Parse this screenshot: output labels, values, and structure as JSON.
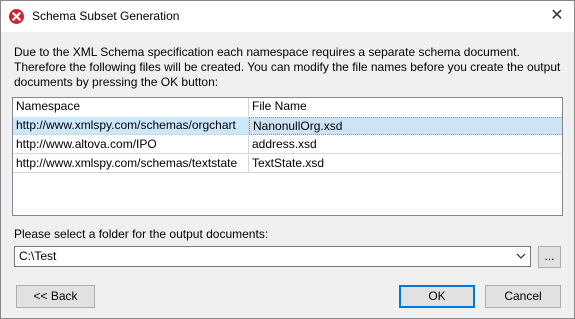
{
  "window": {
    "title": "Schema Subset Generation",
    "close_glyph": "✕"
  },
  "description": {
    "line1": "Due to the XML Schema specification each namespace requires a separate schema document.",
    "line2": "Therefore the following files will be created. You can modify the file names before you create the output",
    "line3": "documents by pressing the OK button:"
  },
  "table": {
    "headers": {
      "namespace": "Namespace",
      "file_name": "File Name"
    },
    "rows": [
      {
        "namespace": "http://www.xmlspy.com/schemas/orgchart",
        "file_name": "NanonullOrg.xsd",
        "selected": true
      },
      {
        "namespace": "http://www.altova.com/IPO",
        "file_name": "address.xsd",
        "selected": false
      },
      {
        "namespace": "http://www.xmlspy.com/schemas/textstate",
        "file_name": "TextState.xsd",
        "selected": false
      }
    ]
  },
  "folder": {
    "label": "Please select a folder for the output documents:",
    "value": "C:\\Test",
    "browse_label": "..."
  },
  "buttons": {
    "back_label": "<<  Back",
    "ok_label": "OK",
    "cancel_label": "Cancel"
  },
  "colors": {
    "app_icon": "#c8282e",
    "selection": "#cce8ff",
    "focus_border": "#0078d7"
  },
  "icons": {
    "app": "altova-app-icon",
    "close": "close-icon",
    "dropdown": "chevron-down-icon"
  }
}
